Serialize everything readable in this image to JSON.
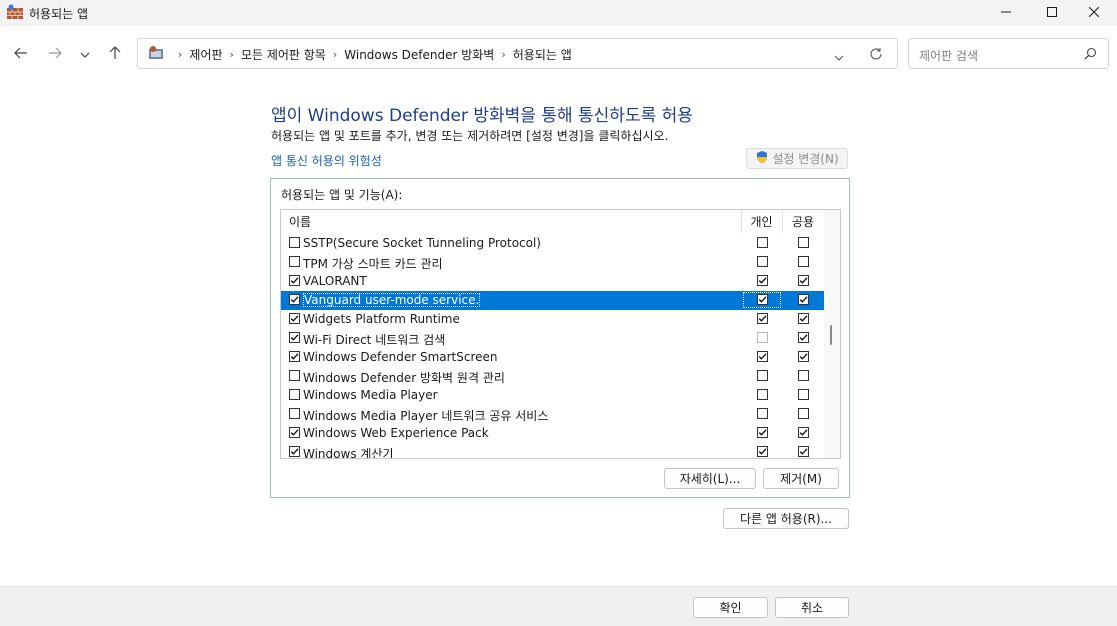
{
  "window": {
    "title": "허용되는 앱",
    "minimize": "Minimize",
    "maximize": "Maximize",
    "close": "Close"
  },
  "nav": {
    "breadcrumbs": [
      "제어판",
      "모든 제어판 항목",
      "Windows Defender 방화벽",
      "허용되는 앱"
    ],
    "search_placeholder": "제어판 검색"
  },
  "main": {
    "heading": "앱이 Windows Defender 방화벽을 통해 통신하도록 허용",
    "description": "허용되는 앱 및 포트를 추가, 변경 또는 제거하려면 [설정 변경]을 클릭하십시오.",
    "risk_link": "앱 통신 허용의 위험성",
    "change_settings": "설정 변경(N)",
    "group_label": "허용되는 앱 및 기능(A):",
    "columns": {
      "name": "이름",
      "private": "개인",
      "public": "공용"
    },
    "rows": [
      {
        "name": "SSTP(Secure Socket Tunneling Protocol)",
        "enabled": false,
        "private": false,
        "public": false
      },
      {
        "name": "TPM 가상 스마트 카드 관리",
        "enabled": false,
        "private": false,
        "public": false
      },
      {
        "name": "VALORANT",
        "enabled": true,
        "private": true,
        "public": true
      },
      {
        "name": "Vanguard user-mode service.",
        "enabled": true,
        "private": true,
        "public": true,
        "selected": true
      },
      {
        "name": "Widgets Platform Runtime",
        "enabled": true,
        "private": true,
        "public": true
      },
      {
        "name": "Wi-Fi Direct 네트워크 검색",
        "enabled": true,
        "private": false,
        "public": true,
        "private_disabled": true
      },
      {
        "name": "Windows Defender SmartScreen",
        "enabled": true,
        "private": true,
        "public": true
      },
      {
        "name": "Windows Defender 방화벽 원격 관리",
        "enabled": false,
        "private": false,
        "public": false
      },
      {
        "name": "Windows Media Player",
        "enabled": false,
        "private": false,
        "public": false
      },
      {
        "name": "Windows Media Player 네트워크 공유 서비스",
        "enabled": false,
        "private": false,
        "public": false
      },
      {
        "name": "Windows Web Experience Pack",
        "enabled": true,
        "private": true,
        "public": true
      },
      {
        "name": "Windows 계산기",
        "enabled": true,
        "private": true,
        "public": true
      }
    ],
    "details_button": "자세히(L)...",
    "remove_button": "제거(M)",
    "allow_other_button": "다른 앱 허용(R)..."
  },
  "footer": {
    "ok": "확인",
    "cancel": "취소"
  }
}
